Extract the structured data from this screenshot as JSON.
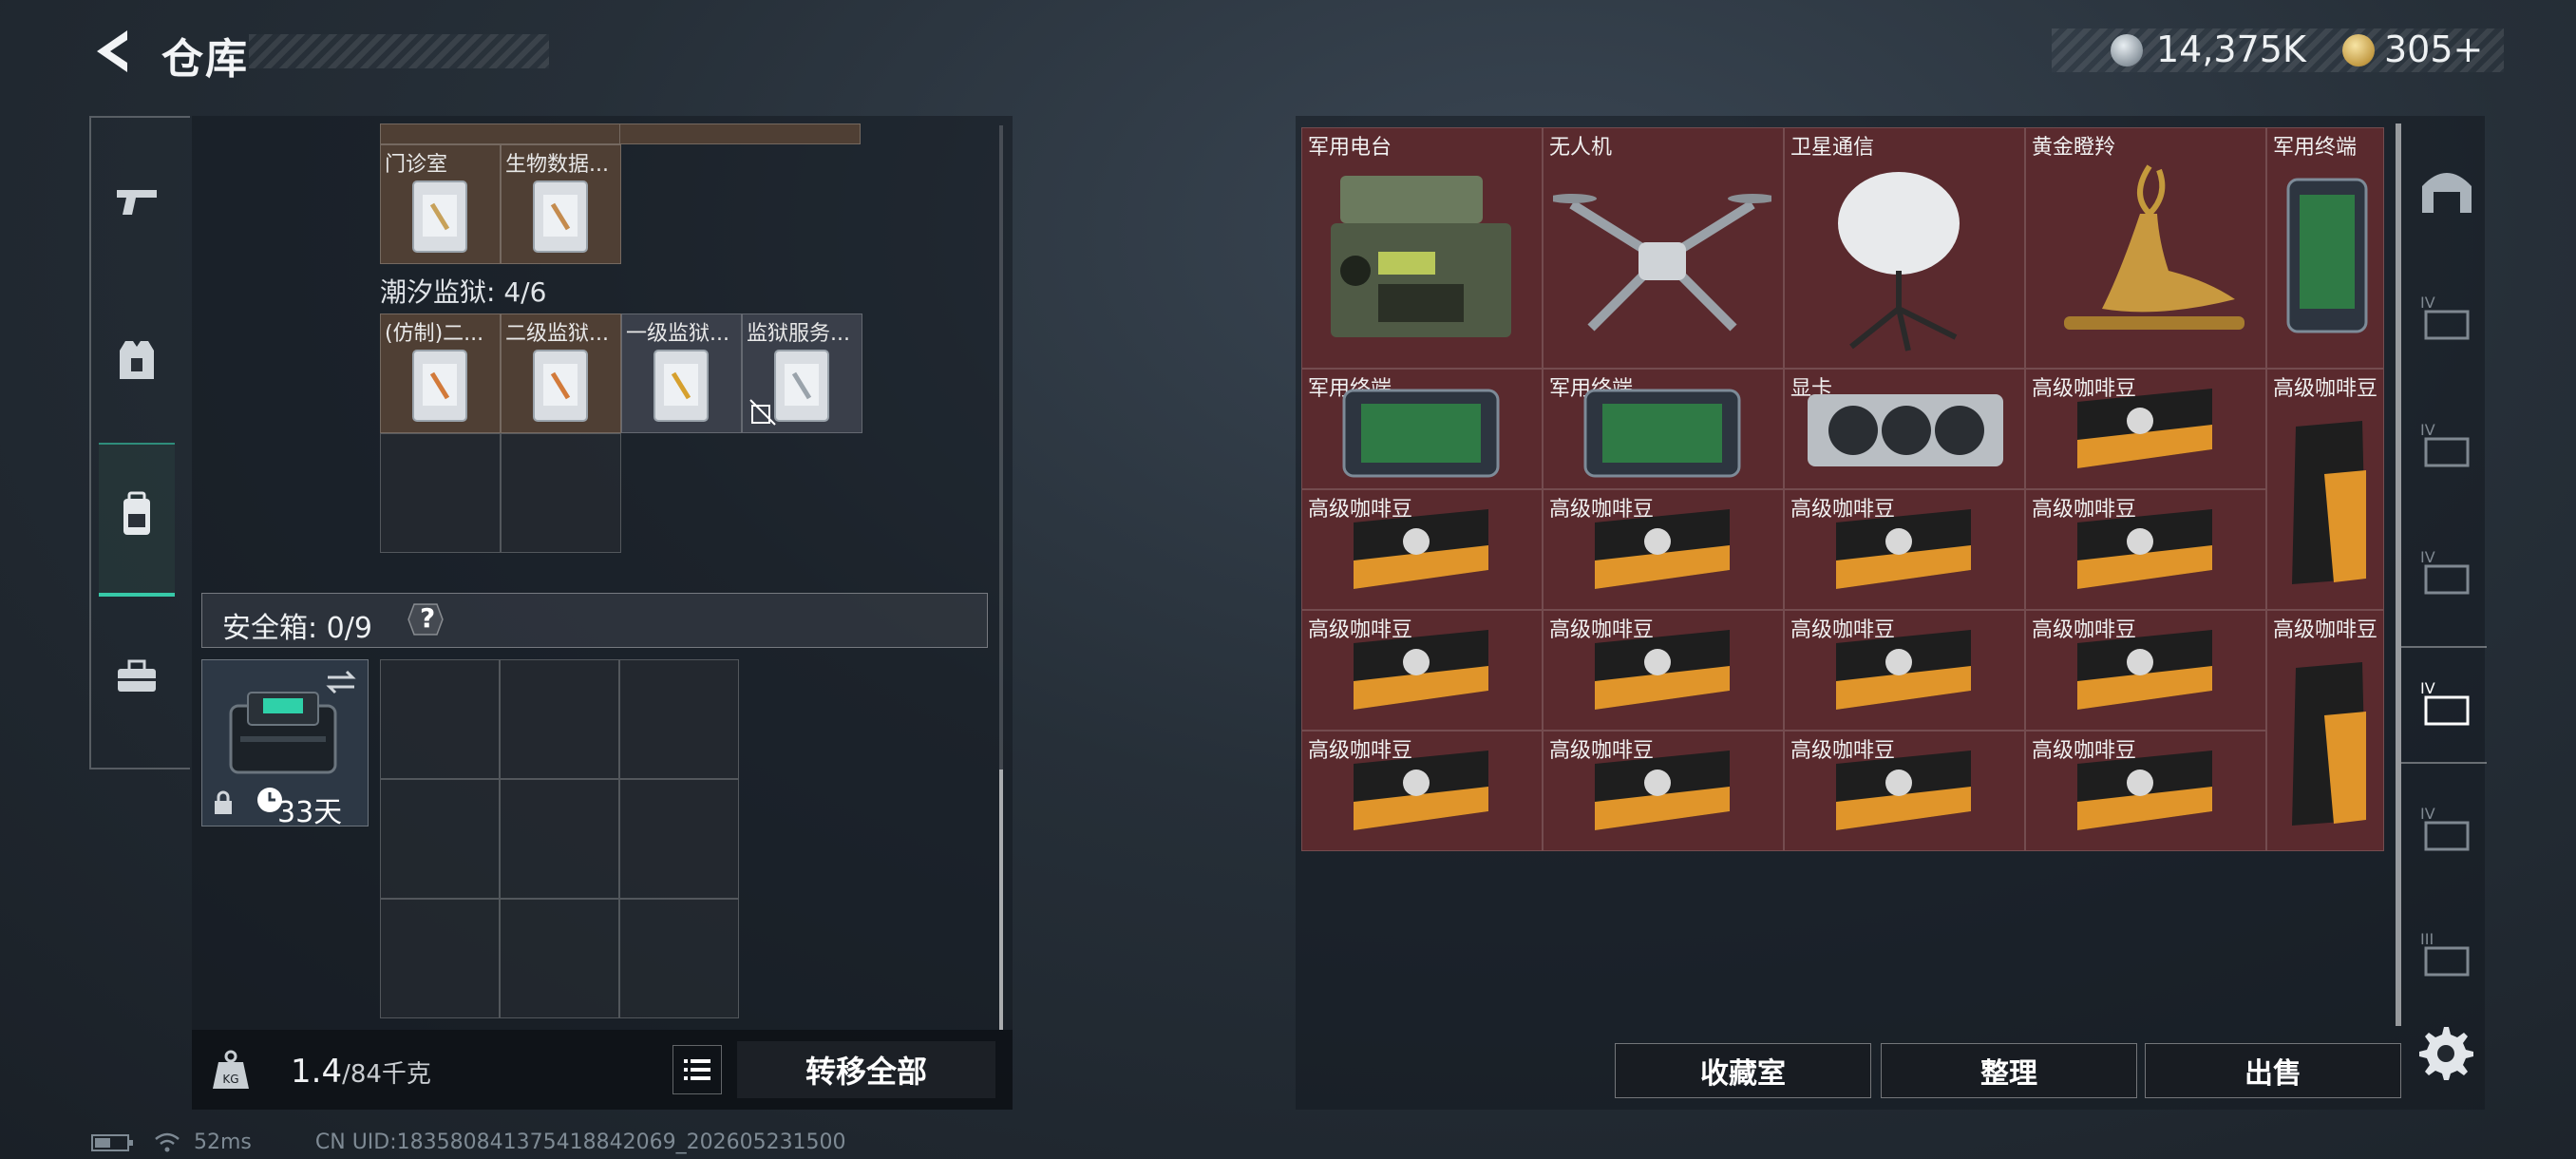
{
  "header": {
    "title": "仓库",
    "currency_silver": "14,375K",
    "currency_gold": "305+"
  },
  "left": {
    "top_row_labels": [
      "门诊室",
      "生物数据..."
    ],
    "prison_section": "潮汐监狱: 4/6",
    "prison_items": [
      "(仿制)二...",
      "二级监狱...",
      "一级监狱...",
      "监狱服务..."
    ],
    "safe_label": "安全箱: 0/9",
    "safe_help": "?",
    "safe_days": "33天",
    "weight_value": "1.4",
    "weight_unit": "/84千克",
    "transfer_all": "转移全部"
  },
  "status": {
    "ping": "52ms",
    "uid": "CN UID:18358084137541884206​9_202605231500"
  },
  "right": {
    "items": [
      {
        "label": "军用电台"
      },
      {
        "label": "无人机"
      },
      {
        "label": "卫星通信"
      },
      {
        "label": "黄金瞪羚"
      },
      {
        "label": "军用终端"
      },
      {
        "label": "军用终端"
      },
      {
        "label": "军用终端"
      },
      {
        "label": "显卡"
      },
      {
        "label": "高级咖啡豆"
      },
      {
        "label": "高级咖啡豆"
      },
      {
        "label": "高级咖啡豆"
      },
      {
        "label": "高级咖啡豆"
      },
      {
        "label": "高级咖啡豆"
      },
      {
        "label": "高级咖啡豆"
      },
      {
        "label": "高级咖啡豆"
      },
      {
        "label": "高级咖啡豆"
      },
      {
        "label": "高级咖啡豆"
      },
      {
        "label": "高级咖啡豆"
      },
      {
        "label": "高级咖啡豆"
      },
      {
        "label": "高级咖啡豆"
      },
      {
        "label": "高级咖啡豆"
      },
      {
        "label": "高级咖啡豆"
      },
      {
        "label": "高级咖啡豆"
      }
    ],
    "buttons": {
      "collection": "收藏室",
      "sort": "整理",
      "sell": "出售"
    }
  },
  "colors": {
    "accent": "#37c9a8",
    "item_bg": "#5a2a2e"
  }
}
